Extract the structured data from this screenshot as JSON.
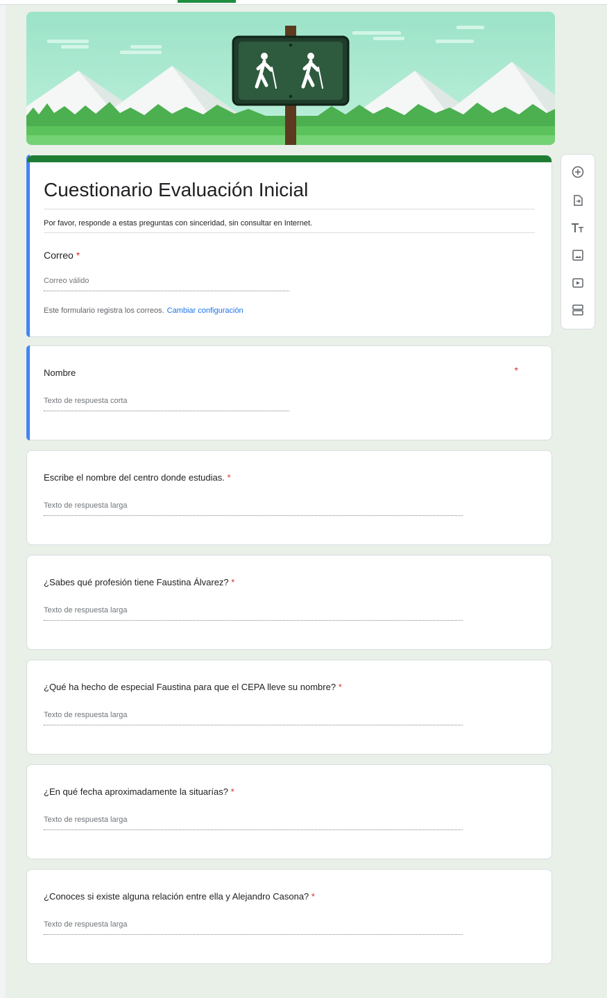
{
  "form": {
    "title": "Cuestionario Evaluación Inicial",
    "description": "Por favor, responde a estas preguntas con sinceridad, sin consultar en Internet.",
    "email_label": "Correo",
    "email_placeholder": "Correo válido",
    "email_note": "Este formulario registra los correos.",
    "email_note_link": "Cambiar configuración",
    "required_mark": "*"
  },
  "questions": [
    {
      "label": "Nombre",
      "placeholder": "Texto de respuesta corta"
    },
    {
      "label": "Escribe el nombre del centro donde estudias.",
      "placeholder": "Texto de respuesta larga"
    },
    {
      "label": "¿Sabes qué profesión tiene Faustina Álvarez?",
      "placeholder": "Texto de respuesta larga"
    },
    {
      "label": "¿Qué ha hecho de especial Faustina para que el CEPA lleve su nombre?",
      "placeholder": "Texto de respuesta larga"
    },
    {
      "label": "¿En qué fecha aproximadamente la situarías?",
      "placeholder": "Texto de respuesta larga"
    },
    {
      "label": "¿Conoces si existe alguna relación entre ella y Alejandro Casona?",
      "placeholder": "Texto de respuesta larga"
    }
  ],
  "sidebar": {
    "icons": [
      "add-question-icon",
      "import-questions-icon",
      "add-title-icon",
      "add-image-icon",
      "add-video-icon",
      "add-section-icon"
    ]
  },
  "colors": {
    "accent_blue": "#4285f4",
    "theme_green": "#1e7d32",
    "required_red": "#d93025",
    "link_blue": "#1a73e8",
    "background": "#e8f0e8"
  }
}
